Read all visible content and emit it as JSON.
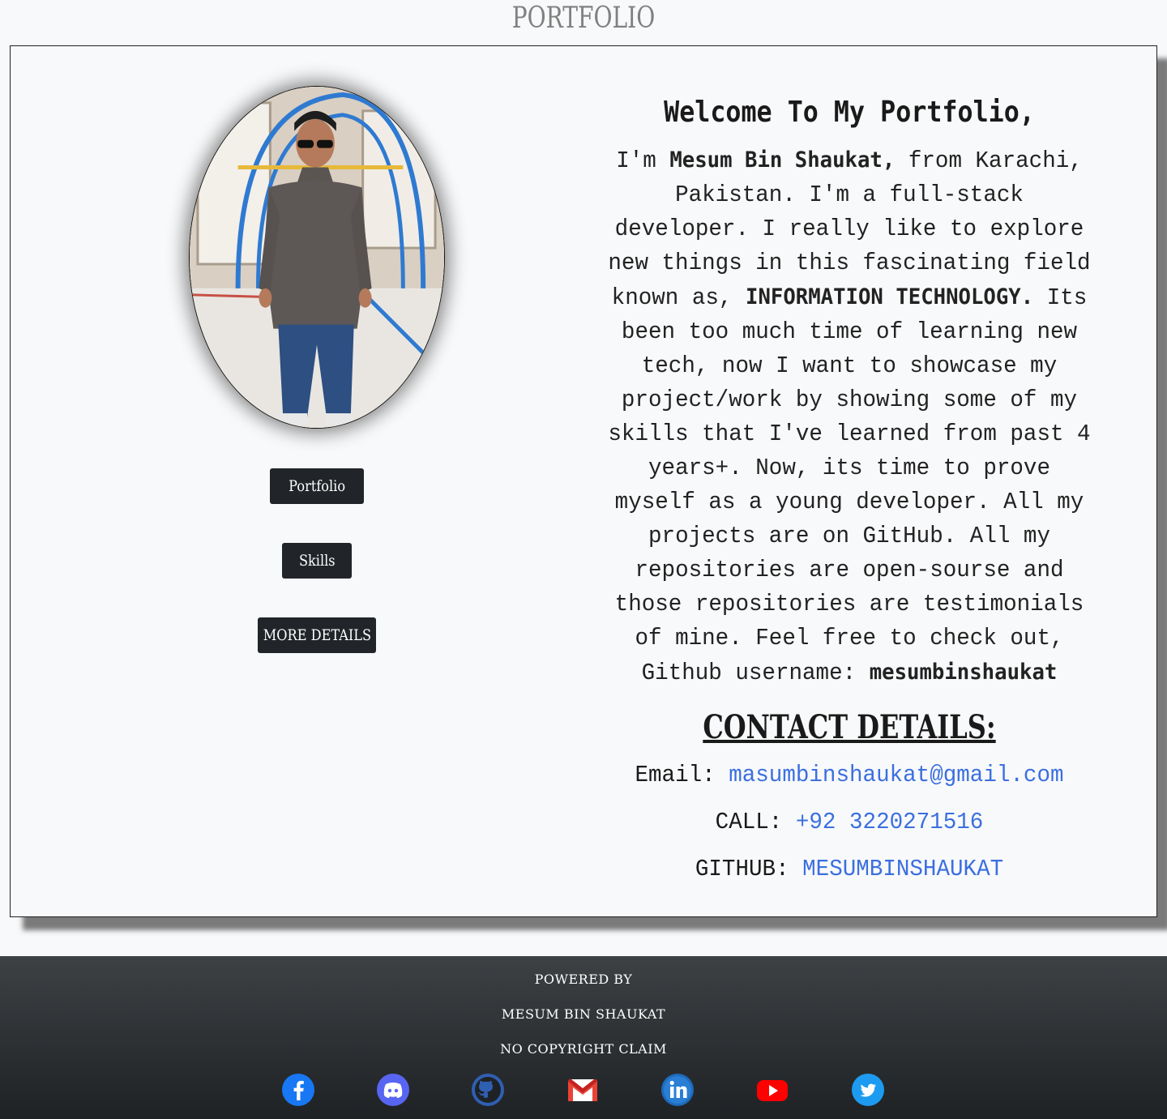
{
  "header": {
    "title": "PORTFOLIO"
  },
  "sidebar": {
    "photo_alt": "Mesum Bin Shaukat",
    "buttons": [
      {
        "label": "Portfolio"
      },
      {
        "label": "Skills"
      },
      {
        "label": "MORE DETAILS"
      }
    ]
  },
  "main": {
    "welcome": "Welcome To My Portfolio,",
    "intro": {
      "part1": "I'm ",
      "name": "Mesum Bin Shaukat,",
      "part2": " from Karachi, Pakistan. I'm a full-stack developer. I really like to explore new things in this fascinating field known as, ",
      "field": "INFORMATION TECHNOLOGY.",
      "part3": " Its been too much time of learning new tech, now I want to showcase my project/work by showing some of my skills that I've learned from past 4 years+. Now, its time to prove myself as a young developer. All my projects are on GitHub. All my repositories are open-sourse and those repositories are testimonials of mine. Feel free to check out, Github username: ",
      "username": "mesumbinshaukat"
    },
    "contact": {
      "heading": "CONTACT DETAILS:",
      "email_label": "Email: ",
      "email": "masumbinshaukat@gmail.com",
      "call_label": "CALL: ",
      "phone": "+92 3220271516",
      "github_label": "GITHUB: ",
      "github": "MESUMBINSHAUKAT"
    }
  },
  "footer": {
    "line1": "POWERED BY",
    "line2": "MESUM BIN SHAUKAT",
    "line3": "NO COPYRIGHT CLAIM",
    "social_icons": [
      "facebook-icon",
      "discord-icon",
      "github-icon",
      "gmail-icon",
      "linkedin-icon",
      "youtube-icon",
      "twitter-icon"
    ]
  },
  "colors": {
    "link": "#3b6fe0",
    "button_bg": "#212529",
    "footer_top": "#3d4144",
    "footer_bottom": "#1f2225",
    "page_bg": "#f8f9fa"
  }
}
